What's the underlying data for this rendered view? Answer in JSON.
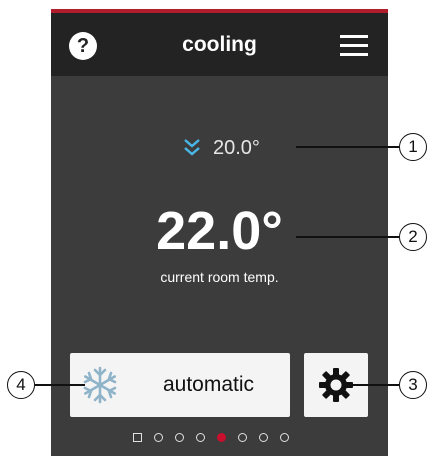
{
  "header": {
    "help_icon": "question-circle-icon",
    "help_label": "?",
    "title": "cooling",
    "menu_icon": "hamburger-menu-icon"
  },
  "setpoint": {
    "icon": "chevron-double-down-icon",
    "value": "20.0°"
  },
  "current": {
    "temperature": "22.0°",
    "label": "current room temp."
  },
  "mode_button": {
    "icon": "snowflake-icon",
    "label": "automatic"
  },
  "settings_button": {
    "icon": "gear-icon"
  },
  "pager": {
    "total_dots": 7,
    "active_index": 4
  },
  "callouts": [
    "1",
    "2",
    "3",
    "4"
  ],
  "colors": {
    "accent": "#b01e2e",
    "header_bg": "#232323",
    "body_bg": "#3c3c3c",
    "chevron": "#49b8e8",
    "snowflake": "#8fb3c8",
    "pager_active": "#c8102e"
  }
}
